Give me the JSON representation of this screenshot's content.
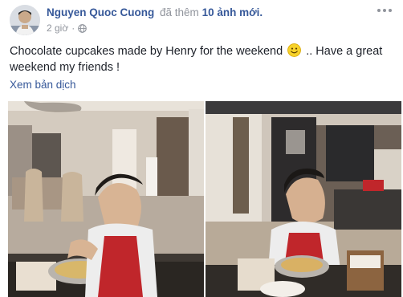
{
  "post": {
    "author": "Nguyen Quoc Cuong",
    "action": "đã thêm",
    "photo_count": "10 ảnh mới.",
    "timestamp": "2 giờ",
    "separator": "·",
    "privacy_icon": "globe-icon",
    "more_icon": "more-dots-icon",
    "caption_before_emoji": "Chocolate cupcakes made by Henry for the weekend",
    "caption_emoji": "smile-emoji",
    "caption_after_emoji": " .. Have a great weekend my friends !",
    "translate_label": "Xem bản dịch"
  },
  "colors": {
    "link": "#365899",
    "muted": "#90949c",
    "text": "#1d2129"
  }
}
